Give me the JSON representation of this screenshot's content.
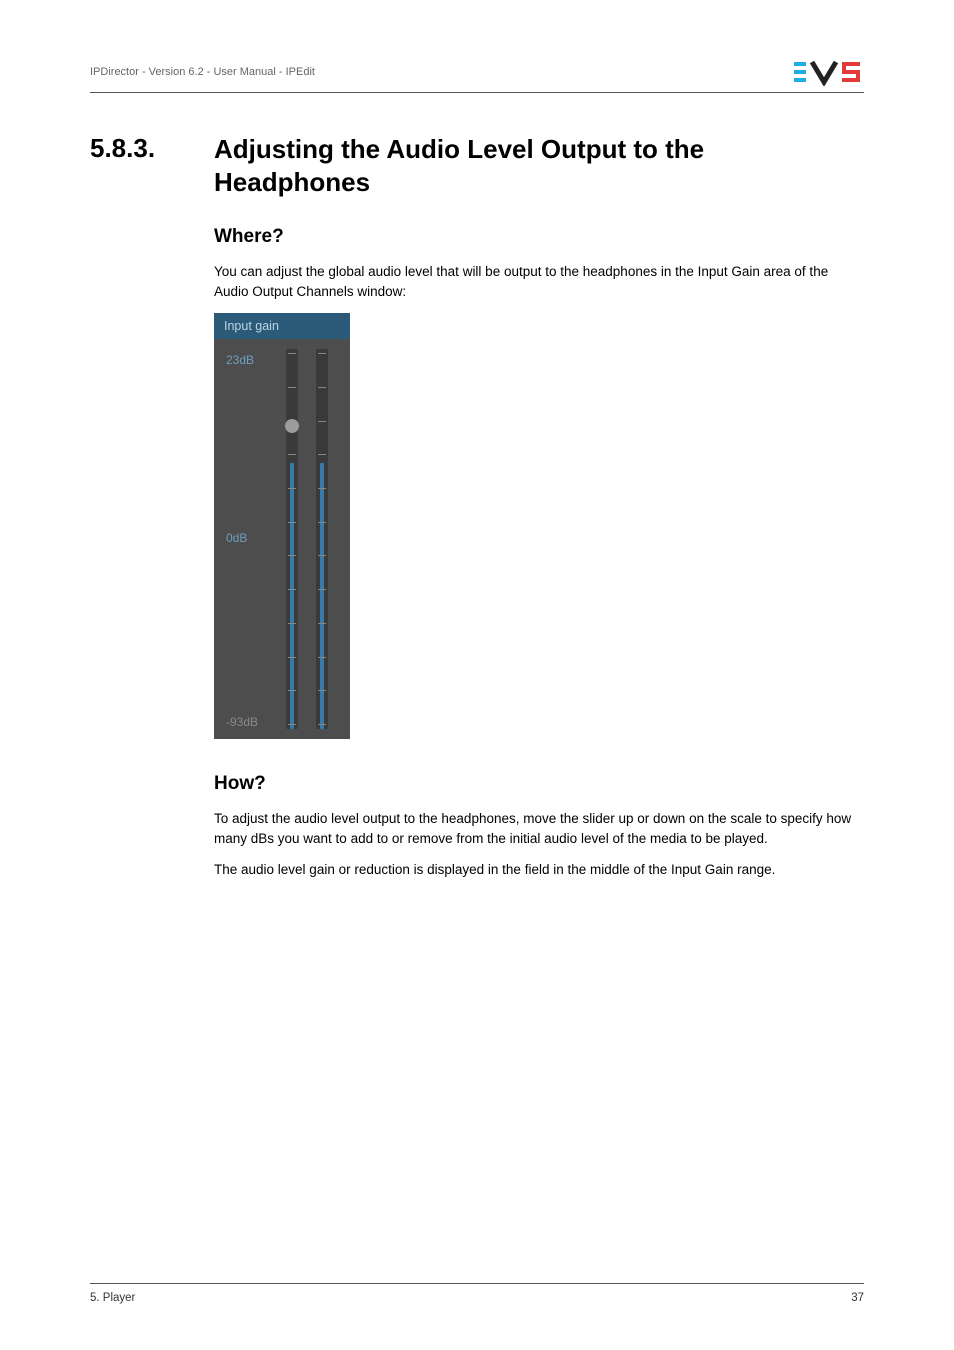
{
  "header": {
    "breadcrumb": "IPDirector - Version 6.2 - User Manual - IPEdit"
  },
  "section": {
    "number": "5.8.3.",
    "title": "Adjusting the Audio Level Output to the Headphones"
  },
  "where": {
    "heading": "Where?",
    "text": "You can adjust the global audio level that will be output to the headphones in the Input Gain area of the Audio Output Channels window:"
  },
  "input_gain": {
    "header": "Input gain",
    "label_top": "23dB",
    "label_mid": "0dB",
    "label_bottom": "-93dB"
  },
  "how": {
    "heading": "How?",
    "p1": "To adjust the audio level output to the headphones, move the slider up or down on the scale to specify how many dBs you want to add to or remove from the initial audio level of the media to be played.",
    "p2": "The audio level gain or reduction is displayed in the field in the middle of the Input Gain range."
  },
  "footer": {
    "left": "5. Player",
    "right": "37"
  }
}
